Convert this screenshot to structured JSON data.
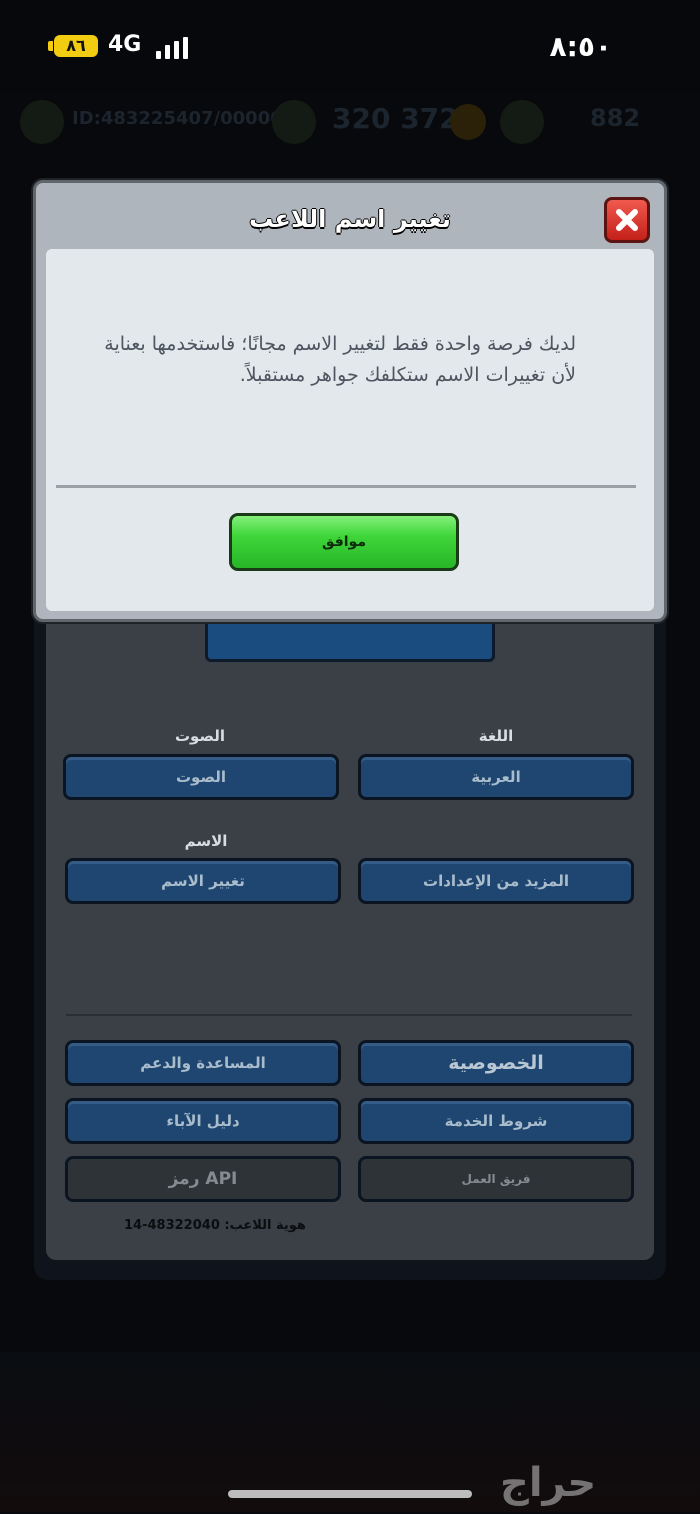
{
  "status_bar": {
    "time": "٨:٥٠",
    "battery": "٨٦",
    "network": "4G"
  },
  "hud": {
    "player_info": "ID:483225407/00000",
    "gems": "320 372",
    "right_count": "882"
  },
  "dialog": {
    "title": "تغيير اسم اللاعب",
    "message": "لديك فرصة واحدة فقط لتغيير الاسم مجانًا؛ فاستخدمها بعناية لأن تغييرات الاسم ستكلفك جواهر مستقبلاً.",
    "ok_label": "موافق"
  },
  "settings": {
    "language_label": "اللغة",
    "language_value": "العربية",
    "sound_label": "الصوت",
    "sound_value": "الصوت",
    "name_label": "الاسم",
    "change_name": "تغيير الاسم",
    "more_settings": "المزيد من الإعدادات",
    "privacy": "الخصوصية",
    "help_support": "المساعدة والدعم",
    "terms": "شروط الخدمة",
    "parents_guide": "دليل الآباء",
    "credits": "فريق العمل",
    "api_token": "رمز API",
    "player_id": "هوية اللاعب: 48322040-14"
  },
  "watermark": "حراج"
}
